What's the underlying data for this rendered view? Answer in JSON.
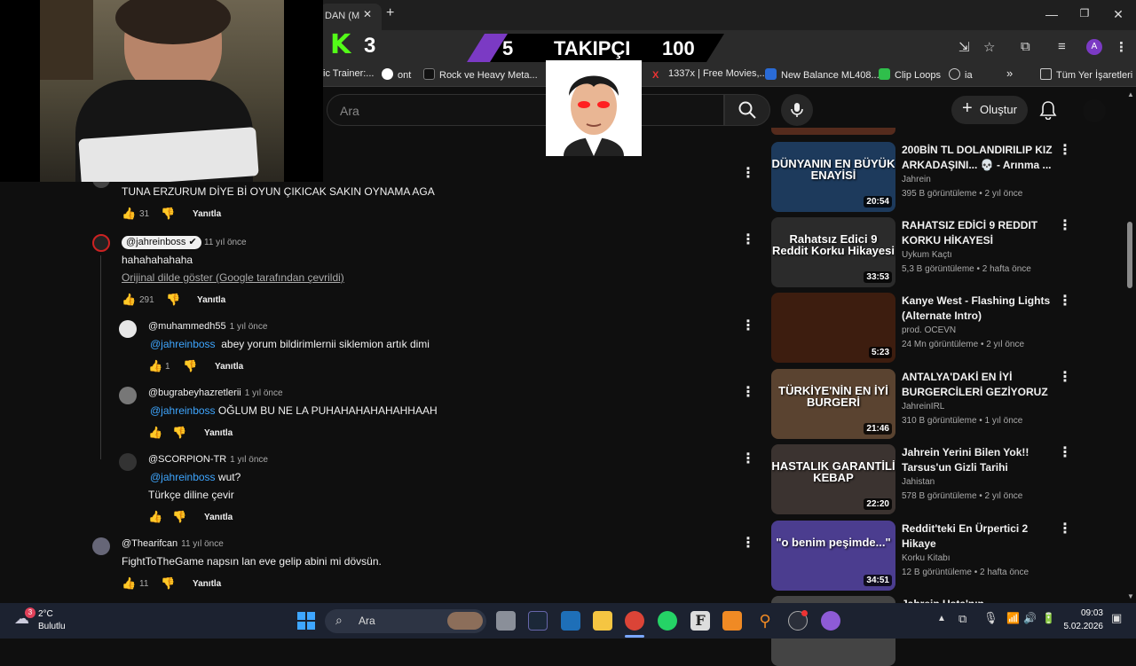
{
  "browser": {
    "active_tab_label": "DAN (M",
    "new_tab_icon": "plus-icon",
    "bookmarks": [
      {
        "label": "ic Trainer:..."
      },
      {
        "label": "ont"
      },
      {
        "label": "Rock ve Heavy Meta..."
      },
      {
        "label": "1337x | Free Movies,..."
      },
      {
        "label": "New Balance ML408..."
      },
      {
        "label": "Clip Loops"
      },
      {
        "label": "ia"
      }
    ],
    "all_bookmarks_label": "Tüm Yer İşaretleri",
    "profile_initial": "A"
  },
  "overlay": {
    "kick_count": "3",
    "follower_current": "5",
    "follower_label": "TAKIPÇI",
    "follower_goal": "100"
  },
  "youtube": {
    "search_placeholder": "Ara",
    "create_label": "Oluştur"
  },
  "comments": [
    {
      "text": "TUNA ERZURUM DİYE Bİ OYUN ÇIKICAK SAKIN OYNAMA AGA",
      "likes": "31",
      "reply_label": "Yanıtla"
    },
    {
      "author": "@jahreinboss",
      "time": "11 yıl önce",
      "text": "hahahahahaha",
      "translate_label": "Orijinal dilde göster (Google tarafından çevrildi)",
      "likes": "291",
      "reply_label": "Yanıtla",
      "replies": [
        {
          "author": "@muhammedh55",
          "time": "1 yıl önce",
          "mention": "@jahreinboss",
          "text": "abey yorum bildirimlernii siklemion artık dimi",
          "likes": "1",
          "reply_label": "Yanıtla"
        },
        {
          "author": "@bugrabeyhazretlerii",
          "time": "1 yıl önce",
          "mention": "@jahreinboss",
          "text": "OĞLUM BU NE LA PUHAHAHAHAHAHHAAH",
          "reply_label": "Yanıtla"
        },
        {
          "author": "@SCORPION-TR",
          "time": "1 yıl önce",
          "mention": "@jahreinboss",
          "text": "wut?",
          "text2": "Türkçe diline çevir",
          "reply_label": "Yanıtla"
        }
      ]
    },
    {
      "author": "@Thearifcan",
      "time": "11 yıl önce",
      "text": "FightToTheGame napsın lan eve gelip abini mi dövsün.",
      "likes": "11",
      "reply_label": "Yanıtla"
    }
  ],
  "recommendations": [
    {
      "title": "200BİN TL DOLANDIRILIP KIZ ARKADAŞINI... 💀 - Arınma ...",
      "channel": "Jahrein",
      "meta": "395 B görüntüleme • 2 yıl önce",
      "duration": "20:54",
      "thumb_text": "DÜNYANIN EN BÜYÜK ENAYİSİ",
      "thumb_color": "#1d3a5c"
    },
    {
      "title": "RAHATSIZ EDİCİ 9 REDDIT KORKU HİKAYESİ",
      "channel": "Uykum Kaçtı",
      "meta": "5,3 B görüntüleme • 2 hafta önce",
      "duration": "33:53",
      "thumb_text": "Rahatsız Edici 9 Reddit Korku Hikayesi",
      "thumb_color": "#2b2b2b"
    },
    {
      "title": "Kanye West - Flashing Lights (Alternate Intro)",
      "channel": "prod. OCEVN",
      "meta": "24 Mn görüntüleme • 2 yıl önce",
      "duration": "5:23",
      "thumb_text": "",
      "thumb_color": "#3d1d0f"
    },
    {
      "title": "ANTALYA'DAKİ EN İYİ BURGERCİLERİ GEZİYORUZ w...",
      "channel": "JahreinIRL",
      "meta": "310 B görüntüleme • 1 yıl önce",
      "duration": "21:46",
      "thumb_text": "TÜRKİYE'NİN EN İYİ BURGERİ",
      "thumb_color": "#5a4330"
    },
    {
      "title": "Jahrein Yerini Bilen Yok!! Tarsus'un Gizli Tarihi Kebapçısı",
      "channel": "Jahistan",
      "meta": "578 B görüntüleme • 2 yıl önce",
      "duration": "22:20",
      "thumb_text": "HASTALIK GARANTİLİ KEBAP",
      "thumb_color": "#3b3330"
    },
    {
      "title": "Reddit'teki En Ürpertici 2 Hikaye",
      "channel": "Korku Kitabı",
      "meta": "12 B görüntüleme • 2 hafta önce",
      "duration": "34:51",
      "thumb_text": "\"o benim peşimde...\"",
      "thumb_color": "#4b3d8f"
    },
    {
      "title": "Jahrein Usta'nın Mutfağından...",
      "channel": "",
      "meta": "",
      "duration": "",
      "thumb_text": "",
      "thumb_color": "#444444"
    }
  ],
  "taskbar": {
    "weather_temp": "2°C",
    "weather_desc": "Bulutlu",
    "weather_badge": "3",
    "search_label": "Ara",
    "time": "09:03",
    "date": "5.02.2026"
  }
}
